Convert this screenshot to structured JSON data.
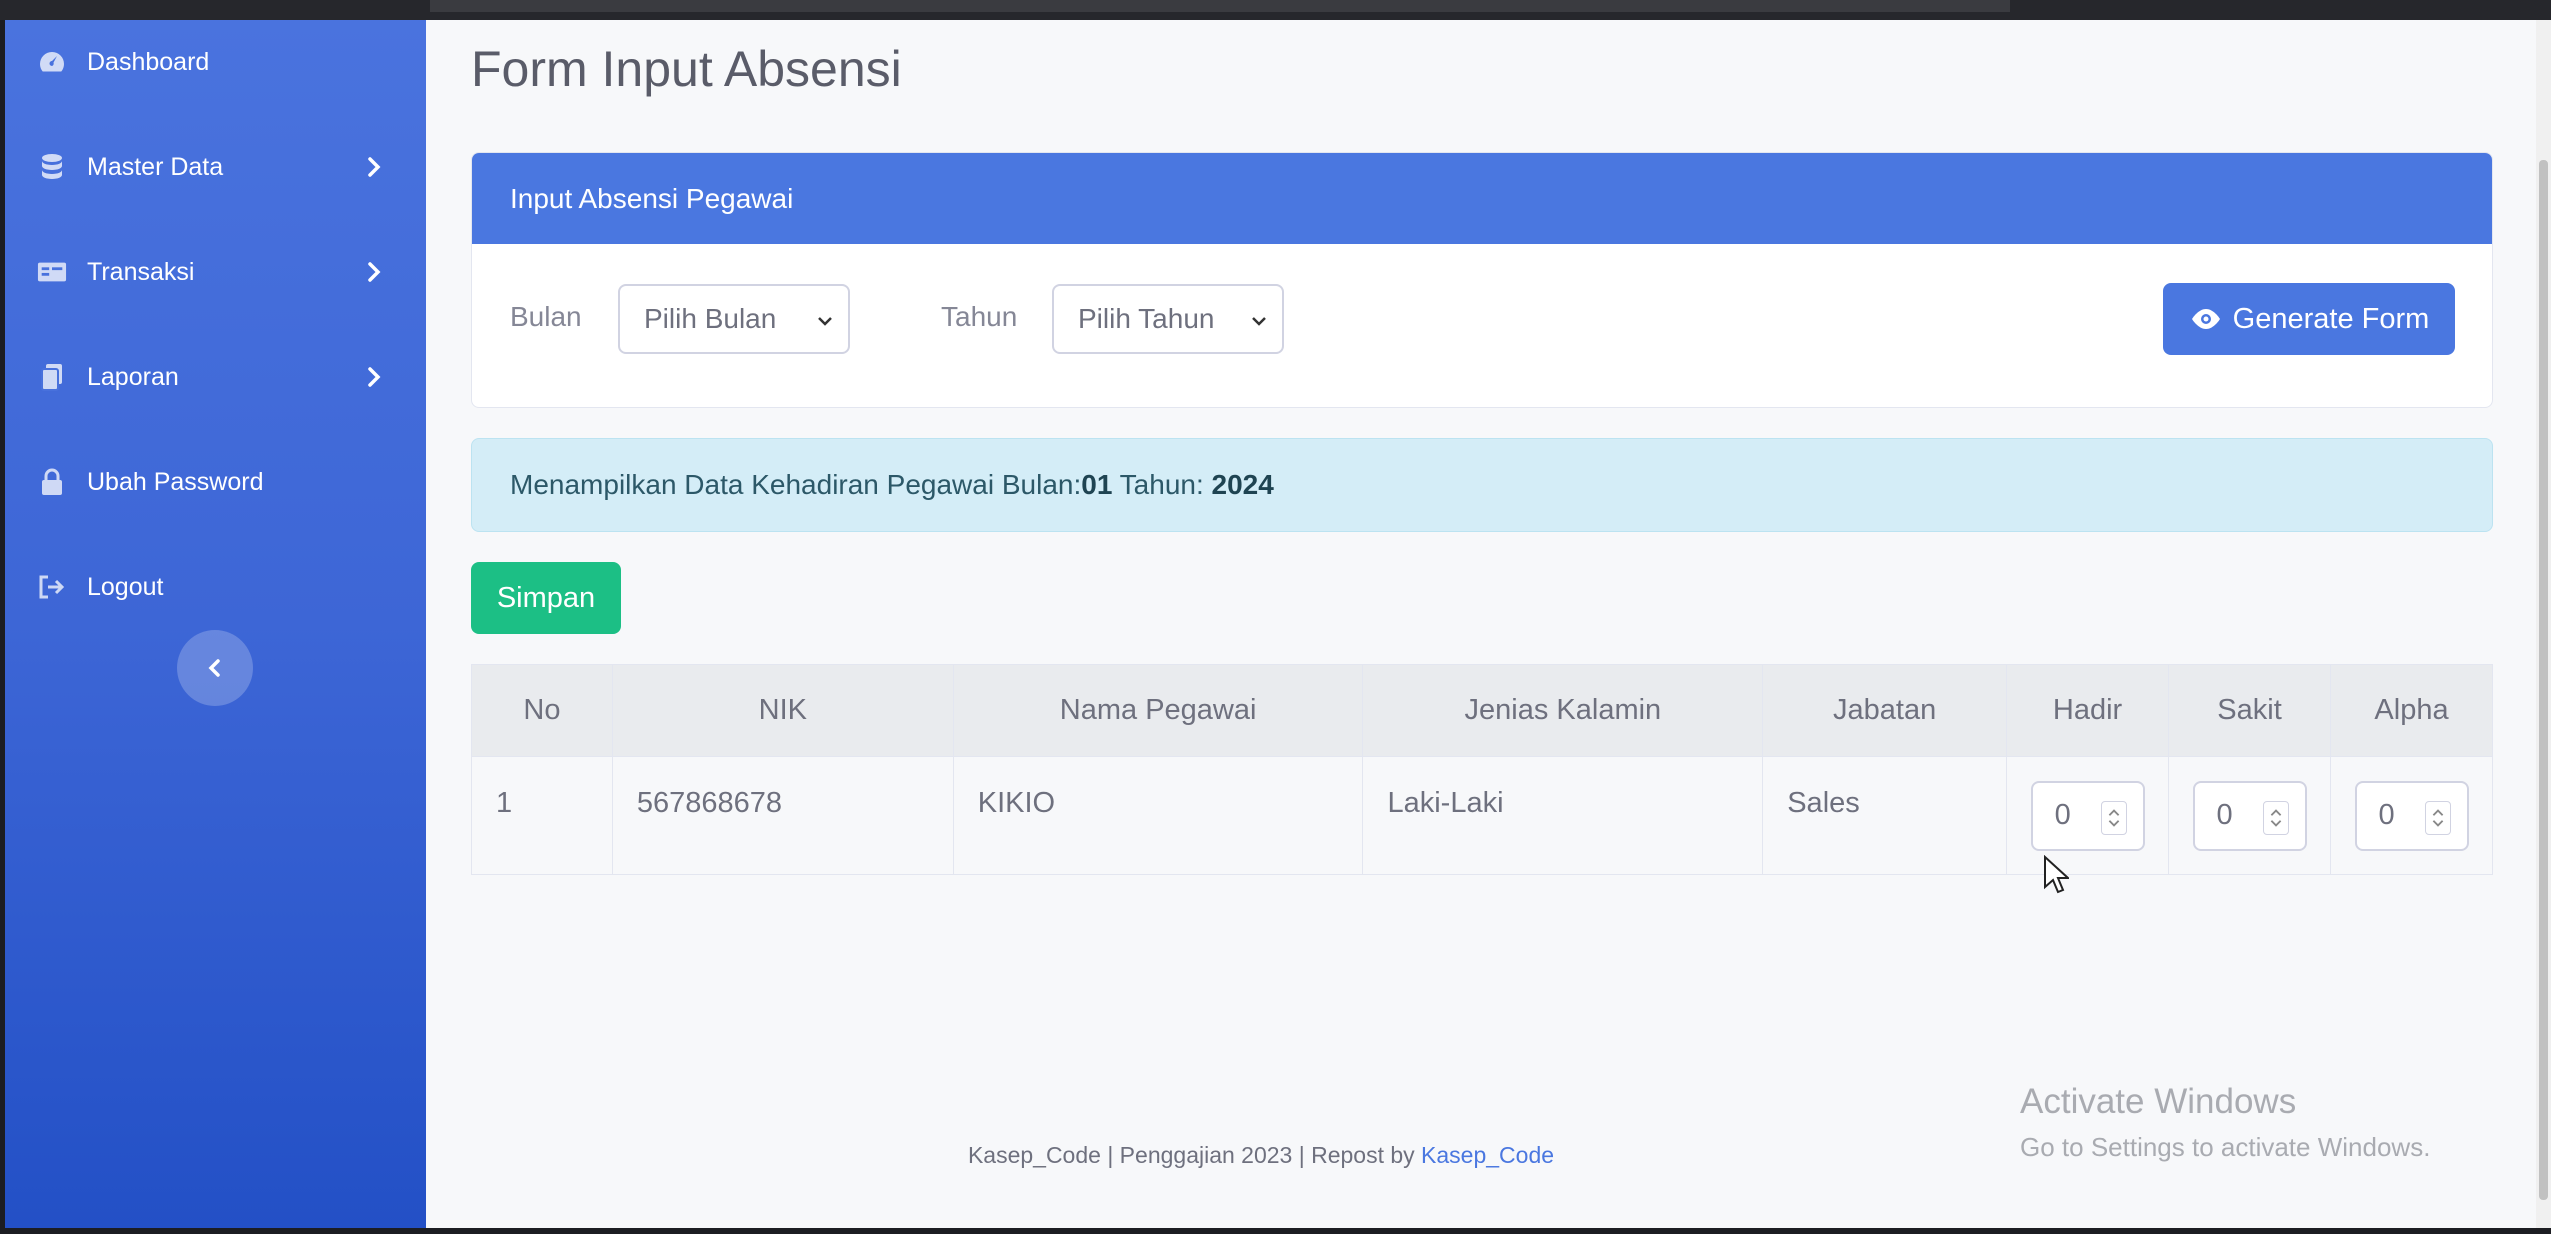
{
  "sidebar": {
    "items": [
      {
        "label": "Dashboard",
        "icon": "dashboard-icon"
      },
      {
        "label": "Master Data",
        "icon": "database-icon"
      },
      {
        "label": "Transaksi",
        "icon": "transaction-icon"
      },
      {
        "label": "Laporan",
        "icon": "report-icon"
      },
      {
        "label": "Ubah Password",
        "icon": "lock-icon"
      },
      {
        "label": "Logout",
        "icon": "logout-icon"
      }
    ]
  },
  "page": {
    "title": "Form Input Absensi"
  },
  "card": {
    "header": "Input Absensi Pegawai",
    "bulan_label": "Bulan",
    "bulan_value": "Pilih Bulan",
    "tahun_label": "Tahun",
    "tahun_value": "Pilih Tahun",
    "generate_label": "Generate Form"
  },
  "alert": {
    "text": "Menampilkan Data Kehadiran Pegawai Bulan: ",
    "bulan": "01",
    "tahun_text": " Tahun: ",
    "tahun": "2024"
  },
  "save_label": "Simpan",
  "table": {
    "headers": [
      "No",
      "NIK",
      "Nama Pegawai",
      "Jenias Kalamin",
      "Jabatan",
      "Hadir",
      "Sakit",
      "Alpha"
    ],
    "rows": [
      {
        "no": "1",
        "nik": "567868678",
        "nama": "KIKIO",
        "jk": "Laki-Laki",
        "jabatan": "Sales",
        "hadir": "0",
        "sakit": "0",
        "alpha": "0"
      }
    ]
  },
  "footer": {
    "text": "Kasep_Code | Penggajian 2023 | Repost by ",
    "link": "Kasep_Code"
  },
  "watermark": {
    "title": "Activate Windows",
    "subtitle": "Go to Settings to activate Windows."
  },
  "colors": {
    "primary": "#4a77e0",
    "success": "#1cbf85",
    "info_bg": "#d4edf7"
  }
}
